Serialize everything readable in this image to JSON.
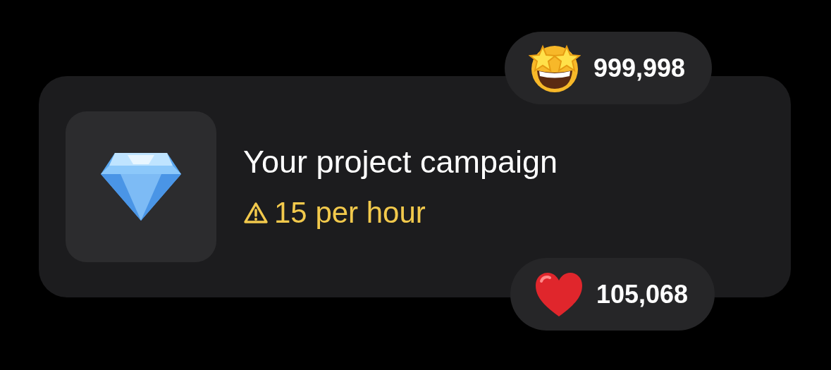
{
  "card": {
    "title": "Your project campaign",
    "rate": "15 per hour"
  },
  "badges": [
    {
      "kind": "star-struck",
      "count": "999,998"
    },
    {
      "kind": "heart",
      "count": "105,068"
    }
  ]
}
